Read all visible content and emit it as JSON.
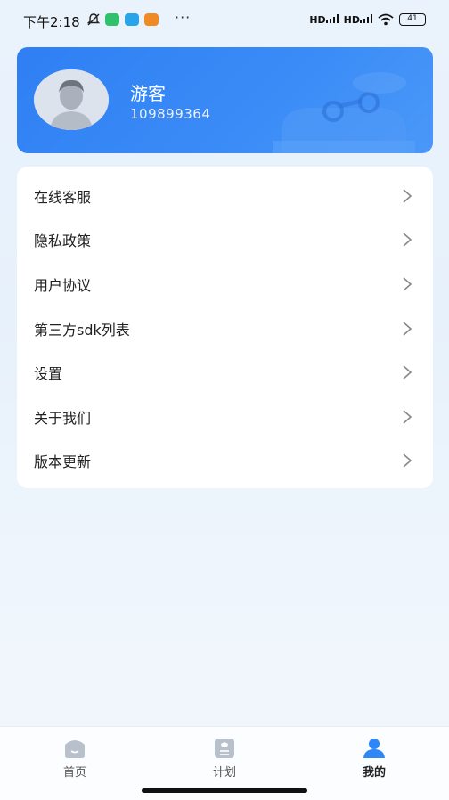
{
  "status_bar": {
    "time": "下午2:18",
    "signal_1": "HD",
    "signal_2": "HD",
    "battery": "41",
    "more": "···"
  },
  "profile": {
    "name": "游客",
    "user_id": "109899364"
  },
  "menu": {
    "items": [
      {
        "label": "在线客服"
      },
      {
        "label": "隐私政策"
      },
      {
        "label": "用户协议"
      },
      {
        "label": "第三方sdk列表"
      },
      {
        "label": "设置"
      },
      {
        "label": "关于我们"
      },
      {
        "label": "版本更新"
      }
    ]
  },
  "tabs": [
    {
      "label": "首页",
      "icon": "home-icon",
      "active": false
    },
    {
      "label": "计划",
      "icon": "plan-icon",
      "active": false
    },
    {
      "label": "我的",
      "icon": "profile-icon",
      "active": true
    }
  ],
  "colors": {
    "accent": "#2f7ff3",
    "active_tab_icon": "#2f86f6",
    "inactive_tab_icon": "#b8c0cc"
  }
}
